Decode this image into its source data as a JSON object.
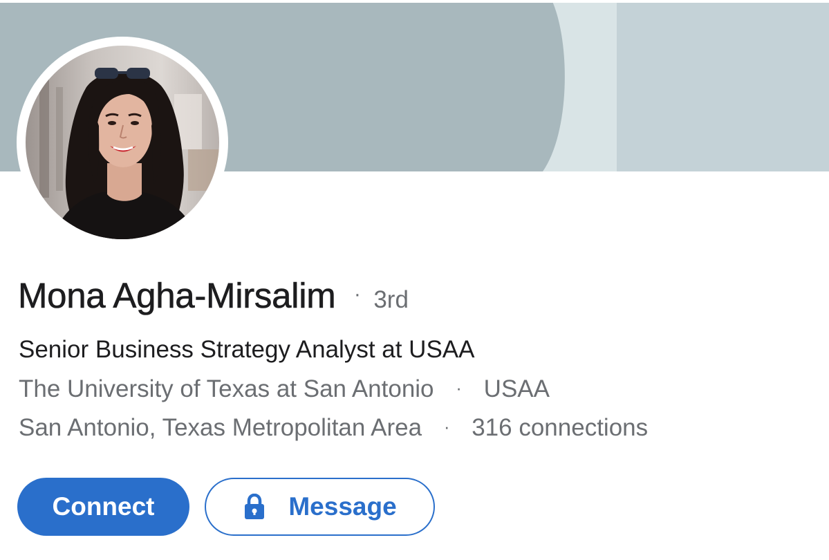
{
  "profile": {
    "name": "Mona Agha-Mirsalim",
    "separator": "·",
    "degree": "3rd",
    "headline": "Senior Business Strategy Analyst at USAA",
    "education": "The University of Texas at San Antonio",
    "company": "USAA",
    "location": "San Antonio, Texas Metropolitan Area",
    "connections": "316 connections"
  },
  "actions": {
    "connect_label": "Connect",
    "message_label": "Message",
    "message_icon": "lock-icon"
  },
  "colors": {
    "accent": "#2a6fcb",
    "banner": "#a8b8bd",
    "text_primary": "#1d1d1f",
    "text_secondary": "#6b6e72"
  }
}
